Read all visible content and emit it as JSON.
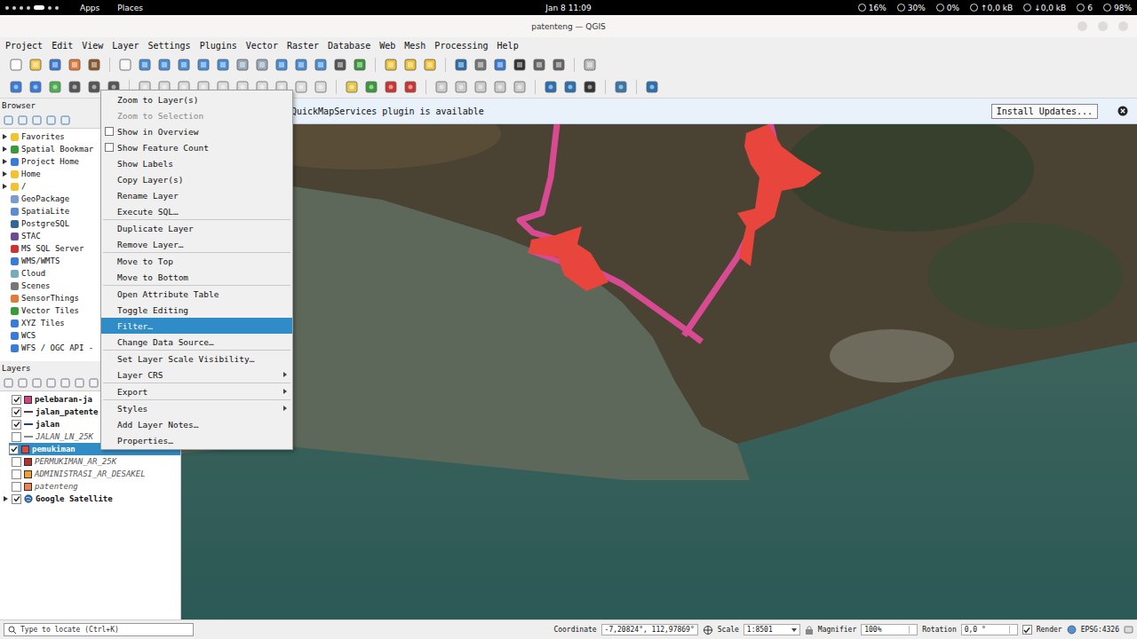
{
  "system_bar": {
    "left": [
      "Apps",
      "Places"
    ],
    "clock": "Jan 8 11:09",
    "indicators": [
      {
        "label": "16%"
      },
      {
        "label": "30%"
      },
      {
        "label": "0%"
      },
      {
        "label": "↑0,0 kB"
      },
      {
        "label": "↓0,0 kB"
      },
      {
        "label": "6"
      },
      {
        "label": "98%"
      }
    ]
  },
  "window": {
    "title": "patenteng — QGIS"
  },
  "menu_bar": [
    "Project",
    "Edit",
    "View",
    "Layer",
    "Settings",
    "Plugins",
    "Vector",
    "Raster",
    "Database",
    "Web",
    "Mesh",
    "Processing",
    "Help"
  ],
  "message_bar": {
    "text": "QuickMapServices plugin is available",
    "button": "Install Updates..."
  },
  "browser": {
    "title": "Browser",
    "items": [
      {
        "label": "Favorites",
        "expandable": true
      },
      {
        "label": "Spatial Bookmar",
        "expandable": true
      },
      {
        "label": "Project Home",
        "expandable": true
      },
      {
        "label": "Home",
        "expandable": true
      },
      {
        "label": "/",
        "expandable": true
      },
      {
        "label": "GeoPackage",
        "expandable": false
      },
      {
        "label": "SpatiaLite",
        "expandable": false
      },
      {
        "label": "PostgreSQL",
        "expandable": false
      },
      {
        "label": "STAC",
        "expandable": false
      },
      {
        "label": "MS SQL Server",
        "expandable": false
      },
      {
        "label": "WMS/WMTS",
        "expandable": false
      },
      {
        "label": "Cloud",
        "expandable": false
      },
      {
        "label": "Scenes",
        "expandable": false
      },
      {
        "label": "SensorThings",
        "expandable": false
      },
      {
        "label": "Vector Tiles",
        "expandable": false
      },
      {
        "label": "XYZ Tiles",
        "expandable": false
      },
      {
        "label": "WCS",
        "expandable": false
      },
      {
        "label": "WFS / OGC API -",
        "expandable": false
      }
    ]
  },
  "layers": {
    "title": "Layers",
    "items": [
      {
        "label": "pelebaran-ja",
        "checked": true,
        "selected": false,
        "expandable": false,
        "kind": "polygon",
        "color": "#d6407f"
      },
      {
        "label": "jalan_patente",
        "checked": true,
        "selected": false,
        "expandable": false,
        "kind": "line",
        "color": "#5a3a4a"
      },
      {
        "label": "jalan",
        "checked": true,
        "selected": false,
        "expandable": false,
        "kind": "line",
        "color": "#2b3a8c"
      },
      {
        "label": "JALAN_LN_25K",
        "checked": false,
        "selected": false,
        "expandable": false,
        "kind": "line",
        "color": "#8a8a8a"
      },
      {
        "label": "pemukiman",
        "checked": true,
        "selected": true,
        "expandable": false,
        "kind": "polygon",
        "color": "#e0483c"
      },
      {
        "label": "PERMUKIMAN_AR_25K",
        "checked": false,
        "selected": false,
        "expandable": false,
        "kind": "polygon",
        "color": "#b8302e"
      },
      {
        "label": "ADMINISTRASI_AR_DESAKEL",
        "checked": false,
        "selected": false,
        "expandable": false,
        "kind": "polygon",
        "color": "#f0a030"
      },
      {
        "label": "patenteng",
        "checked": false,
        "selected": false,
        "expandable": false,
        "kind": "polygon",
        "color": "#f08050"
      },
      {
        "label": "Google Satellite",
        "checked": true,
        "selected": false,
        "expandable": true,
        "kind": "raster",
        "color": "#2a6fb0"
      }
    ]
  },
  "context_menu": {
    "items": [
      {
        "label": "Zoom to Layer(s)",
        "kind": "action",
        "disabled": false,
        "selected": false,
        "submenu": false,
        "separator_before": false
      },
      {
        "label": "Zoom to Selection",
        "kind": "action",
        "disabled": true,
        "selected": false,
        "submenu": false,
        "separator_before": false
      },
      {
        "label": "Show in Overview",
        "kind": "check",
        "checked": false,
        "disabled": false,
        "selected": false,
        "submenu": false,
        "separator_before": false
      },
      {
        "label": "Show Feature Count",
        "kind": "check",
        "checked": false,
        "disabled": false,
        "selected": false,
        "submenu": false,
        "separator_before": false
      },
      {
        "label": "Show Labels",
        "kind": "action",
        "disabled": false,
        "selected": false,
        "submenu": false,
        "separator_before": false
      },
      {
        "label": "Copy Layer(s)",
        "kind": "action",
        "disabled": false,
        "selected": false,
        "submenu": false,
        "separator_before": false
      },
      {
        "label": "Rename Layer",
        "kind": "action",
        "disabled": false,
        "selected": false,
        "submenu": false,
        "separator_before": false
      },
      {
        "label": "Execute SQL…",
        "kind": "action",
        "disabled": false,
        "selected": false,
        "submenu": false,
        "separator_before": false
      },
      {
        "label": "Duplicate Layer",
        "kind": "action",
        "disabled": false,
        "selected": false,
        "submenu": false,
        "separator_before": true
      },
      {
        "label": "Remove Layer…",
        "kind": "action",
        "disabled": false,
        "selected": false,
        "submenu": false,
        "separator_before": false
      },
      {
        "label": "Move to Top",
        "kind": "action",
        "disabled": false,
        "selected": false,
        "submenu": false,
        "separator_before": true
      },
      {
        "label": "Move to Bottom",
        "kind": "action",
        "disabled": false,
        "selected": false,
        "submenu": false,
        "separator_before": false
      },
      {
        "label": "Open Attribute Table",
        "kind": "action",
        "disabled": false,
        "selected": false,
        "submenu": false,
        "separator_before": true
      },
      {
        "label": "Toggle Editing",
        "kind": "action",
        "disabled": false,
        "selected": false,
        "submenu": false,
        "separator_before": false
      },
      {
        "label": "Filter…",
        "kind": "action",
        "disabled": false,
        "selected": true,
        "submenu": false,
        "separator_before": false
      },
      {
        "label": "Change Data Source…",
        "kind": "action",
        "disabled": false,
        "selected": false,
        "submenu": false,
        "separator_before": false
      },
      {
        "label": "Set Layer Scale Visibility…",
        "kind": "action",
        "disabled": false,
        "selected": false,
        "submenu": false,
        "separator_before": true
      },
      {
        "label": "Layer CRS",
        "kind": "action",
        "disabled": false,
        "selected": false,
        "submenu": true,
        "separator_before": false
      },
      {
        "label": "Export",
        "kind": "action",
        "disabled": false,
        "selected": false,
        "submenu": true,
        "separator_before": true
      },
      {
        "label": "Styles",
        "kind": "action",
        "disabled": false,
        "selected": false,
        "submenu": true,
        "separator_before": true
      },
      {
        "label": "Add Layer Notes…",
        "kind": "action",
        "disabled": false,
        "selected": false,
        "submenu": false,
        "separator_before": false
      },
      {
        "label": "Properties…",
        "kind": "action",
        "disabled": false,
        "selected": false,
        "submenu": false,
        "separator_before": false
      }
    ]
  },
  "status_bar": {
    "search_placeholder": "Type to locate (Ctrl+K)",
    "coordinate_label": "Coordinate",
    "coordinate": "-7,20824°, 112,97869°",
    "scale_label": "Scale",
    "scale": "1:8501",
    "magnifier_label": "Magnifier",
    "magnifier": "100%",
    "rotation_label": "Rotation",
    "rotation": "0,0 °",
    "render_label": "Render",
    "render_checked": true,
    "crs": "EPSG:4326"
  }
}
